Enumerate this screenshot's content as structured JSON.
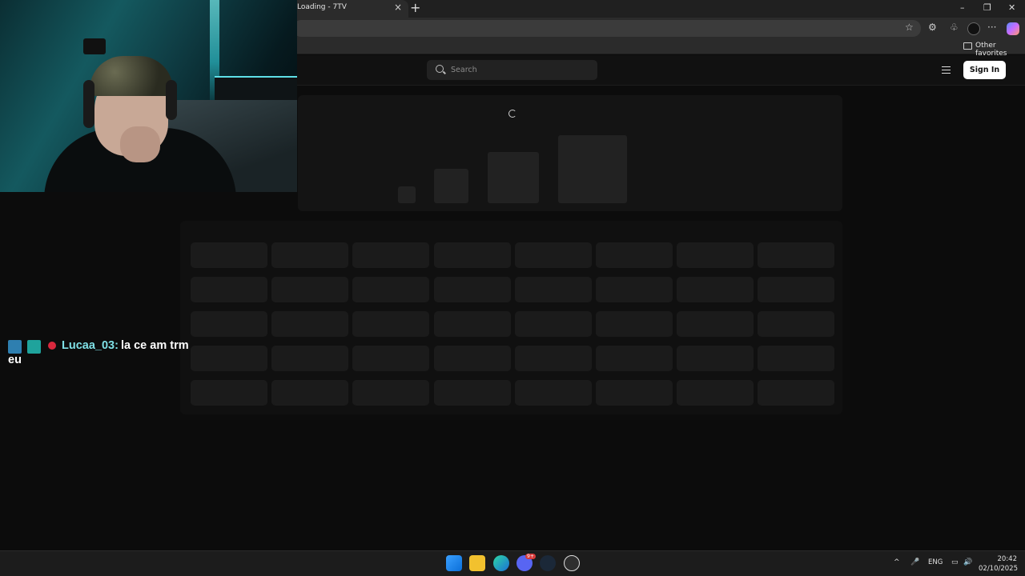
{
  "browser": {
    "tab_title": "Loading - 7TV",
    "tab_close": "×",
    "new_tab": "+",
    "window_controls": {
      "minimize": "–",
      "restore": "❐",
      "close": "✕"
    },
    "toolbar_icons": [
      "star-icon",
      "extensions-icon",
      "collections-icon",
      "profile-icon",
      "more-icon",
      "copilot-icon"
    ],
    "toolbar_glyphs": {
      "star": "☆",
      "extensions": "⚙",
      "collections": "♧",
      "more": "···"
    },
    "favorites_label": "Other favorites"
  },
  "site": {
    "search_placeholder": "Search",
    "signin_label": "Sign In",
    "accent": "#ffffff"
  },
  "chat": {
    "username": "Lucaa_03:",
    "message_line1": "la ce am trm",
    "message_line2": "eu",
    "username_color": "#7fe0e6"
  },
  "taskbar": {
    "apps": [
      "windows-start-icon",
      "file-explorer-icon",
      "edge-icon",
      "discord-icon",
      "steam-icon",
      "obs-icon"
    ],
    "discord_badge": "9+",
    "tray_chevron": "^",
    "tray_mic": "🎤",
    "language": "ENG",
    "tray_network": "▭",
    "tray_volume": "🔊",
    "time": "20:42",
    "date": "02/10/2025"
  }
}
